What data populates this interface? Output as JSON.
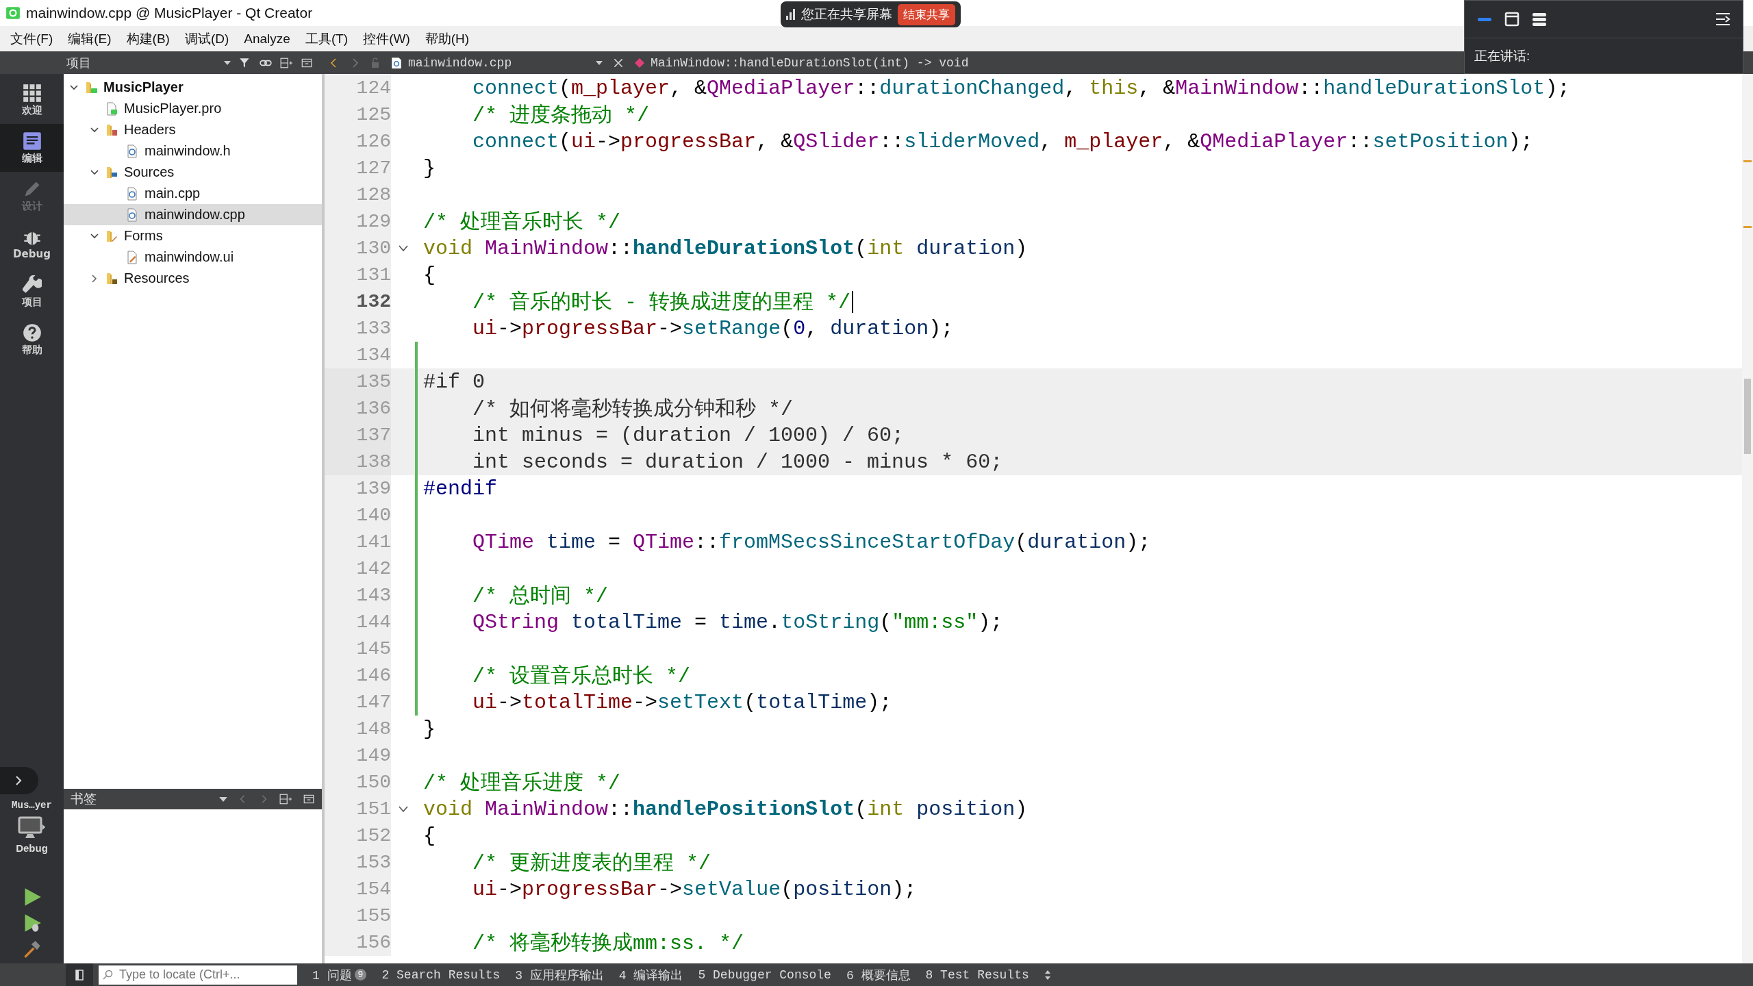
{
  "window": {
    "title": "mainwindow.cpp @ MusicPlayer - Qt Creator"
  },
  "share_banner": {
    "status": "您正在共享屏幕",
    "button": "结束共享"
  },
  "meeting_panel": {
    "speaking_label": "正在讲话:"
  },
  "menu": [
    "文件(F)",
    "编辑(E)",
    "构建(B)",
    "调试(D)",
    "Analyze",
    "工具(T)",
    "控件(W)",
    "帮助(H)"
  ],
  "modes": [
    {
      "kind": "welcome",
      "label": "欢迎",
      "selected": false,
      "disabled": false
    },
    {
      "kind": "edit",
      "label": "编辑",
      "selected": true,
      "disabled": false
    },
    {
      "kind": "design",
      "label": "设计",
      "selected": false,
      "disabled": true
    },
    {
      "kind": "debug",
      "label": "Debug",
      "selected": false,
      "disabled": false
    },
    {
      "kind": "projects",
      "label": "项目",
      "selected": false,
      "disabled": false
    },
    {
      "kind": "help",
      "label": "帮助",
      "selected": false,
      "disabled": false
    }
  ],
  "target": {
    "project": "Mus…yer",
    "build": "Debug"
  },
  "project_pane": {
    "title": "项目",
    "tree": [
      {
        "kind": "project",
        "label": "MusicPlayer",
        "expanded": true,
        "selected": false,
        "children": [
          {
            "kind": "pro",
            "label": "MusicPlayer.pro",
            "selected": false
          },
          {
            "kind": "headers",
            "label": "Headers",
            "expanded": true,
            "selected": false,
            "children": [
              {
                "kind": "header",
                "label": "mainwindow.h",
                "selected": false
              }
            ]
          },
          {
            "kind": "sources",
            "label": "Sources",
            "expanded": true,
            "selected": false,
            "children": [
              {
                "kind": "source",
                "label": "main.cpp",
                "selected": false
              },
              {
                "kind": "source",
                "label": "mainwindow.cpp",
                "selected": true
              }
            ]
          },
          {
            "kind": "forms",
            "label": "Forms",
            "expanded": true,
            "selected": false,
            "children": [
              {
                "kind": "form",
                "label": "mainwindow.ui",
                "selected": false
              }
            ]
          },
          {
            "kind": "resources",
            "label": "Resources",
            "expanded": false,
            "selected": false
          }
        ]
      }
    ]
  },
  "bookmarks_pane": {
    "title": "书签"
  },
  "editor": {
    "file": "mainwindow.cpp",
    "symbol": "MainWindow::handleDurationSlot(int) -> void",
    "lines": [
      {
        "number": "124",
        "current": false,
        "modified": false,
        "inactive": false,
        "foldable": false,
        "tokens": [
          {
            "kind": "fn",
            "text": "    connect"
          },
          {
            "kind": "plain",
            "text": "("
          },
          {
            "kind": "field",
            "text": "m_player"
          },
          {
            "kind": "plain",
            "text": ", &"
          },
          {
            "kind": "type",
            "text": "QMediaPlayer"
          },
          {
            "kind": "plain",
            "text": "::"
          },
          {
            "kind": "fn",
            "text": "durationChanged"
          },
          {
            "kind": "plain",
            "text": ", "
          },
          {
            "kind": "keyword",
            "text": "this"
          },
          {
            "kind": "plain",
            "text": ", &"
          },
          {
            "kind": "type",
            "text": "MainWindow"
          },
          {
            "kind": "plain",
            "text": "::"
          },
          {
            "kind": "fn",
            "text": "handleDurationSlot"
          },
          {
            "kind": "plain",
            "text": ");"
          }
        ]
      },
      {
        "number": "125",
        "current": false,
        "modified": false,
        "inactive": false,
        "foldable": false,
        "tokens": [
          {
            "kind": "comment",
            "text": "    /* 进度条拖动 */"
          }
        ]
      },
      {
        "number": "126",
        "current": false,
        "modified": false,
        "inactive": false,
        "foldable": false,
        "tokens": [
          {
            "kind": "fn",
            "text": "    connect"
          },
          {
            "kind": "plain",
            "text": "("
          },
          {
            "kind": "field",
            "text": "ui"
          },
          {
            "kind": "plain",
            "text": "->"
          },
          {
            "kind": "field",
            "text": "progressBar"
          },
          {
            "kind": "plain",
            "text": ", &"
          },
          {
            "kind": "type",
            "text": "QSlider"
          },
          {
            "kind": "plain",
            "text": "::"
          },
          {
            "kind": "fn",
            "text": "sliderMoved"
          },
          {
            "kind": "plain",
            "text": ", "
          },
          {
            "kind": "field",
            "text": "m_player"
          },
          {
            "kind": "plain",
            "text": ", &"
          },
          {
            "kind": "type",
            "text": "QMediaPlayer"
          },
          {
            "kind": "plain",
            "text": "::"
          },
          {
            "kind": "fn",
            "text": "setPosition"
          },
          {
            "kind": "plain",
            "text": ");"
          }
        ]
      },
      {
        "number": "127",
        "current": false,
        "modified": false,
        "inactive": false,
        "foldable": false,
        "tokens": [
          {
            "kind": "plain",
            "text": "}"
          }
        ]
      },
      {
        "number": "128",
        "current": false,
        "modified": false,
        "inactive": false,
        "foldable": false
      },
      {
        "number": "129",
        "current": false,
        "modified": false,
        "inactive": false,
        "foldable": false,
        "tokens": [
          {
            "kind": "comment",
            "text": "/* 处理音乐时长 */"
          }
        ]
      },
      {
        "number": "130",
        "current": false,
        "modified": false,
        "inactive": false,
        "foldable": true,
        "tokens": [
          {
            "kind": "keyword",
            "text": "void"
          },
          {
            "kind": "type",
            "text": " MainWindow"
          },
          {
            "kind": "plain",
            "text": "::"
          },
          {
            "kind": "decl",
            "text": "handleDurationSlot"
          },
          {
            "kind": "plain",
            "text": "("
          },
          {
            "kind": "keyword",
            "text": "int"
          },
          {
            "kind": "param",
            "text": " duration"
          },
          {
            "kind": "plain",
            "text": ")"
          }
        ]
      },
      {
        "number": "131",
        "current": false,
        "modified": false,
        "inactive": false,
        "foldable": false,
        "tokens": [
          {
            "kind": "plain",
            "text": "{"
          }
        ]
      },
      {
        "number": "132",
        "current": true,
        "modified": false,
        "inactive": false,
        "foldable": false,
        "tokens": [
          {
            "kind": "comment",
            "text": "    /* 音乐的时长 - 转换成进度的里程 */"
          }
        ]
      },
      {
        "number": "133",
        "current": false,
        "modified": false,
        "inactive": false,
        "foldable": false,
        "tokens": [
          {
            "kind": "field",
            "text": "    ui"
          },
          {
            "kind": "plain",
            "text": "->"
          },
          {
            "kind": "field",
            "text": "progressBar"
          },
          {
            "kind": "plain",
            "text": "->"
          },
          {
            "kind": "fn",
            "text": "setRange"
          },
          {
            "kind": "plain",
            "text": "("
          },
          {
            "kind": "number",
            "text": "0"
          },
          {
            "kind": "plain",
            "text": ", "
          },
          {
            "kind": "param",
            "text": "duration"
          },
          {
            "kind": "plain",
            "text": ");"
          }
        ]
      },
      {
        "number": "134",
        "current": false,
        "modified": true,
        "inactive": false,
        "foldable": false
      },
      {
        "number": "135",
        "current": false,
        "modified": true,
        "inactive": true,
        "foldable": false,
        "tokens": [
          {
            "kind": "preproc",
            "text": "#if 0"
          }
        ]
      },
      {
        "number": "136",
        "current": false,
        "modified": true,
        "inactive": true,
        "foldable": false,
        "tokens": [
          {
            "kind": "plain",
            "text": "    /* 如何将毫秒转换成分钟和秒 */"
          }
        ]
      },
      {
        "number": "137",
        "current": false,
        "modified": true,
        "inactive": true,
        "foldable": false,
        "tokens": [
          {
            "kind": "plain",
            "text": "    int minus = (duration / 1000) / 60;"
          }
        ]
      },
      {
        "number": "138",
        "current": false,
        "modified": true,
        "inactive": true,
        "foldable": false,
        "tokens": [
          {
            "kind": "plain",
            "text": "    int seconds = duration / 1000 - minus * 60;"
          }
        ]
      },
      {
        "number": "139",
        "current": false,
        "modified": true,
        "inactive": false,
        "foldable": false,
        "tokens": [
          {
            "kind": "preproc",
            "text": "#endif"
          }
        ]
      },
      {
        "number": "140",
        "current": false,
        "modified": true,
        "inactive": false,
        "foldable": false
      },
      {
        "number": "141",
        "current": false,
        "modified": true,
        "inactive": false,
        "foldable": false,
        "tokens": [
          {
            "kind": "type",
            "text": "    QTime"
          },
          {
            "kind": "param",
            "text": " time"
          },
          {
            "kind": "plain",
            "text": " = "
          },
          {
            "kind": "type",
            "text": "QTime"
          },
          {
            "kind": "plain",
            "text": "::"
          },
          {
            "kind": "fn",
            "text": "fromMSecsSinceStartOfDay"
          },
          {
            "kind": "plain",
            "text": "("
          },
          {
            "kind": "param",
            "text": "duration"
          },
          {
            "kind": "plain",
            "text": ");"
          }
        ]
      },
      {
        "number": "142",
        "current": false,
        "modified": true,
        "inactive": false,
        "foldable": false
      },
      {
        "number": "143",
        "current": false,
        "modified": true,
        "inactive": false,
        "foldable": false,
        "tokens": [
          {
            "kind": "comment",
            "text": "    /* 总时间 */"
          }
        ]
      },
      {
        "number": "144",
        "current": false,
        "modified": true,
        "inactive": false,
        "foldable": false,
        "tokens": [
          {
            "kind": "type",
            "text": "    QString"
          },
          {
            "kind": "param",
            "text": " totalTime"
          },
          {
            "kind": "plain",
            "text": " = "
          },
          {
            "kind": "param",
            "text": "time"
          },
          {
            "kind": "plain",
            "text": "."
          },
          {
            "kind": "fn",
            "text": "toString"
          },
          {
            "kind": "plain",
            "text": "("
          },
          {
            "kind": "string",
            "text": "\"mm:ss\""
          },
          {
            "kind": "plain",
            "text": ");"
          }
        ]
      },
      {
        "number": "145",
        "current": false,
        "modified": true,
        "inactive": false,
        "foldable": false
      },
      {
        "number": "146",
        "current": false,
        "modified": true,
        "inactive": false,
        "foldable": false,
        "tokens": [
          {
            "kind": "comment",
            "text": "    /* 设置音乐总时长 */"
          }
        ]
      },
      {
        "number": "147",
        "current": false,
        "modified": true,
        "inactive": false,
        "foldable": false,
        "tokens": [
          {
            "kind": "field",
            "text": "    ui"
          },
          {
            "kind": "plain",
            "text": "->"
          },
          {
            "kind": "field",
            "text": "totalTime"
          },
          {
            "kind": "plain",
            "text": "->"
          },
          {
            "kind": "fn",
            "text": "setText"
          },
          {
            "kind": "plain",
            "text": "("
          },
          {
            "kind": "param",
            "text": "totalTime"
          },
          {
            "kind": "plain",
            "text": ");"
          }
        ]
      },
      {
        "number": "148",
        "current": false,
        "modified": false,
        "inactive": false,
        "foldable": false,
        "tokens": [
          {
            "kind": "plain",
            "text": "}"
          }
        ]
      },
      {
        "number": "149",
        "current": false,
        "modified": false,
        "inactive": false,
        "foldable": false
      },
      {
        "number": "150",
        "current": false,
        "modified": false,
        "inactive": false,
        "foldable": false,
        "tokens": [
          {
            "kind": "comment",
            "text": "/* 处理音乐进度 */"
          }
        ]
      },
      {
        "number": "151",
        "current": false,
        "modified": false,
        "inactive": false,
        "foldable": true,
        "tokens": [
          {
            "kind": "keyword",
            "text": "void"
          },
          {
            "kind": "type",
            "text": " MainWindow"
          },
          {
            "kind": "plain",
            "text": "::"
          },
          {
            "kind": "decl",
            "text": "handlePositionSlot"
          },
          {
            "kind": "plain",
            "text": "("
          },
          {
            "kind": "keyword",
            "text": "int"
          },
          {
            "kind": "param",
            "text": " position"
          },
          {
            "kind": "plain",
            "text": ")"
          }
        ]
      },
      {
        "number": "152",
        "current": false,
        "modified": false,
        "inactive": false,
        "foldable": false,
        "tokens": [
          {
            "kind": "plain",
            "text": "{"
          }
        ]
      },
      {
        "number": "153",
        "current": false,
        "modified": false,
        "inactive": false,
        "foldable": false,
        "tokens": [
          {
            "kind": "comment",
            "text": "    /* 更新进度表的里程 */"
          }
        ]
      },
      {
        "number": "154",
        "current": false,
        "modified": false,
        "inactive": false,
        "foldable": false,
        "tokens": [
          {
            "kind": "field",
            "text": "    ui"
          },
          {
            "kind": "plain",
            "text": "->"
          },
          {
            "kind": "field",
            "text": "progressBar"
          },
          {
            "kind": "plain",
            "text": "->"
          },
          {
            "kind": "fn",
            "text": "setValue"
          },
          {
            "kind": "plain",
            "text": "("
          },
          {
            "kind": "param",
            "text": "position"
          },
          {
            "kind": "plain",
            "text": ");"
          }
        ]
      },
      {
        "number": "155",
        "current": false,
        "modified": false,
        "inactive": false,
        "foldable": false
      },
      {
        "number": "156",
        "current": false,
        "modified": false,
        "inactive": false,
        "foldable": false,
        "tokens": [
          {
            "kind": "comment",
            "text": "    /* 将毫秒转换成mm:ss. */"
          }
        ]
      }
    ]
  },
  "status_bar": {
    "locator_placeholder": "Type to locate (Ctrl+...",
    "panes": [
      {
        "number": "1",
        "label": "问题",
        "badge": "9"
      },
      {
        "number": "2",
        "label": "Search Results"
      },
      {
        "number": "3",
        "label": "应用程序输出"
      },
      {
        "number": "4",
        "label": "编译输出"
      },
      {
        "number": "5",
        "label": "Debugger Console"
      },
      {
        "number": "6",
        "label": "概要信息"
      },
      {
        "number": "8",
        "label": "Test Results"
      }
    ]
  }
}
